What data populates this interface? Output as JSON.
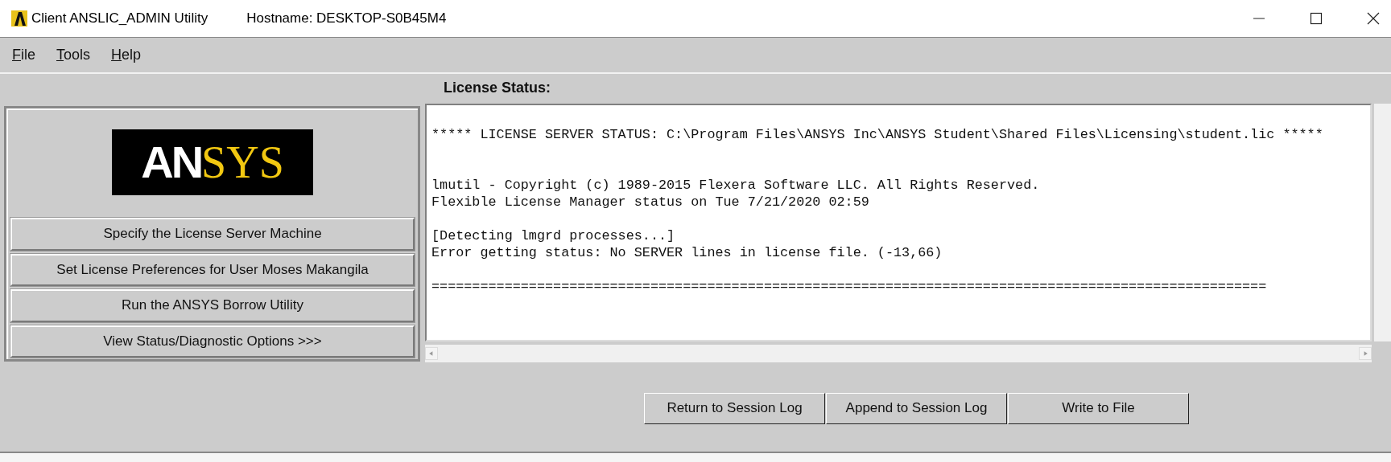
{
  "window": {
    "title": "Client ANSLIC_ADMIN Utility",
    "hostname": "Hostname: DESKTOP-S0B45M4"
  },
  "menu": [
    "File",
    "Tools",
    "Help"
  ],
  "status_label": "License Status:",
  "logo": [
    {
      "text": "AN",
      "color": "#ffffff"
    },
    {
      "text": "SYS",
      "color": "#f2c811"
    }
  ],
  "actions": [
    "Specify the License Server Machine",
    "Set License Preferences for User Moses Makangila",
    "Run the ANSYS Borrow Utility",
    "View Status/Diagnostic Options   >>>"
  ],
  "log": [
    [
      "***** LICENSE SERVER STATUS: C:\\Program Files\\ANSYS Inc\\ANSYS Student\\Shared Files\\Licensing\\student.lic *****"
    ],
    [
      "lmutil - Copyright (c) 1989-2015 Flexera Software LLC. All Rights Reserved.",
      "Flexible License Manager status on Tue 7/21/2020 02:59"
    ],
    [
      "[Detecting lmgrd processes...]",
      "Error getting status: No SERVER lines in license file. (-13,66)"
    ],
    [
      "======================================================================================================="
    ]
  ],
  "buttons": [
    "Return to Session Log",
    "Append to Session Log",
    "Write to File"
  ]
}
